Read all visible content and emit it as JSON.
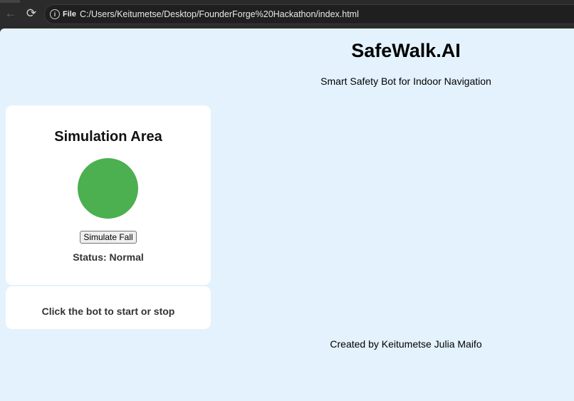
{
  "browser": {
    "scheme_label": "File",
    "url": "C:/Users/Keitumetse/Desktop/FounderForge%20Hackathon/index.html"
  },
  "header": {
    "title": "SafeWalk.AI",
    "subtitle": "Smart Safety Bot for Indoor Navigation"
  },
  "simulation": {
    "heading": "Simulation Area",
    "bot_color": "#4caf50",
    "fall_button_label": "Simulate Fall",
    "status_label": "Status:",
    "status_value": "Normal"
  },
  "hint": {
    "text": "Click the bot to start or stop"
  },
  "footer": {
    "credit": "Created by Keitumetse Julia Maifo"
  },
  "colors": {
    "page_background": "#e3f2fd",
    "card_background": "#ffffff",
    "bot_normal": "#4caf50"
  }
}
